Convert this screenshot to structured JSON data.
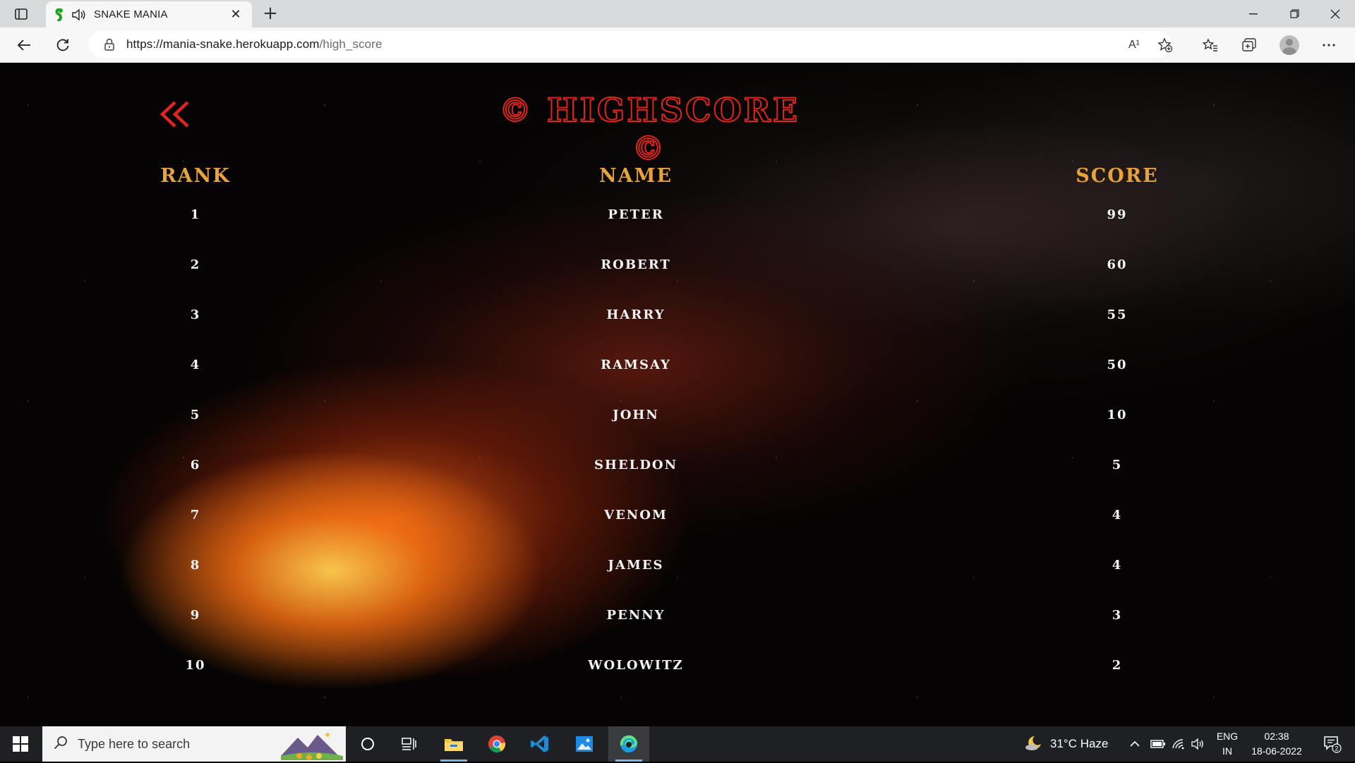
{
  "browser": {
    "tab_title": "SNAKE MANIA",
    "new_tab_symbol": "+",
    "url_host": "https://mania-snake.herokuapp.com",
    "url_path": "/high_score",
    "read_aloud_icon": "A¹"
  },
  "page": {
    "title": "© HIGHSCORE ©",
    "headers": {
      "rank": "RANK",
      "name": "NAME",
      "score": "SCORE"
    },
    "rows": [
      {
        "rank": "1",
        "name": "PETER",
        "score": "99"
      },
      {
        "rank": "2",
        "name": "ROBERT",
        "score": "60"
      },
      {
        "rank": "3",
        "name": "HARRY",
        "score": "55"
      },
      {
        "rank": "4",
        "name": "RAMSAY",
        "score": "50"
      },
      {
        "rank": "5",
        "name": "JOHN",
        "score": "10"
      },
      {
        "rank": "6",
        "name": "SHELDON",
        "score": "5"
      },
      {
        "rank": "7",
        "name": "VENOM",
        "score": "4"
      },
      {
        "rank": "8",
        "name": "JAMES",
        "score": "4"
      },
      {
        "rank": "9",
        "name": "PENNY",
        "score": "3"
      },
      {
        "rank": "10",
        "name": "WOLOWITZ",
        "score": "2"
      }
    ],
    "colors": {
      "title_outline": "#e0261c",
      "header": "#e8a23a",
      "cell": "#f4f4f4"
    }
  },
  "taskbar": {
    "search_placeholder": "Type here to search",
    "weather": "31°C  Haze",
    "lang_top": "ENG",
    "lang_bottom": "IN",
    "time": "02:38",
    "date": "18-06-2022",
    "notification_count": "2"
  }
}
